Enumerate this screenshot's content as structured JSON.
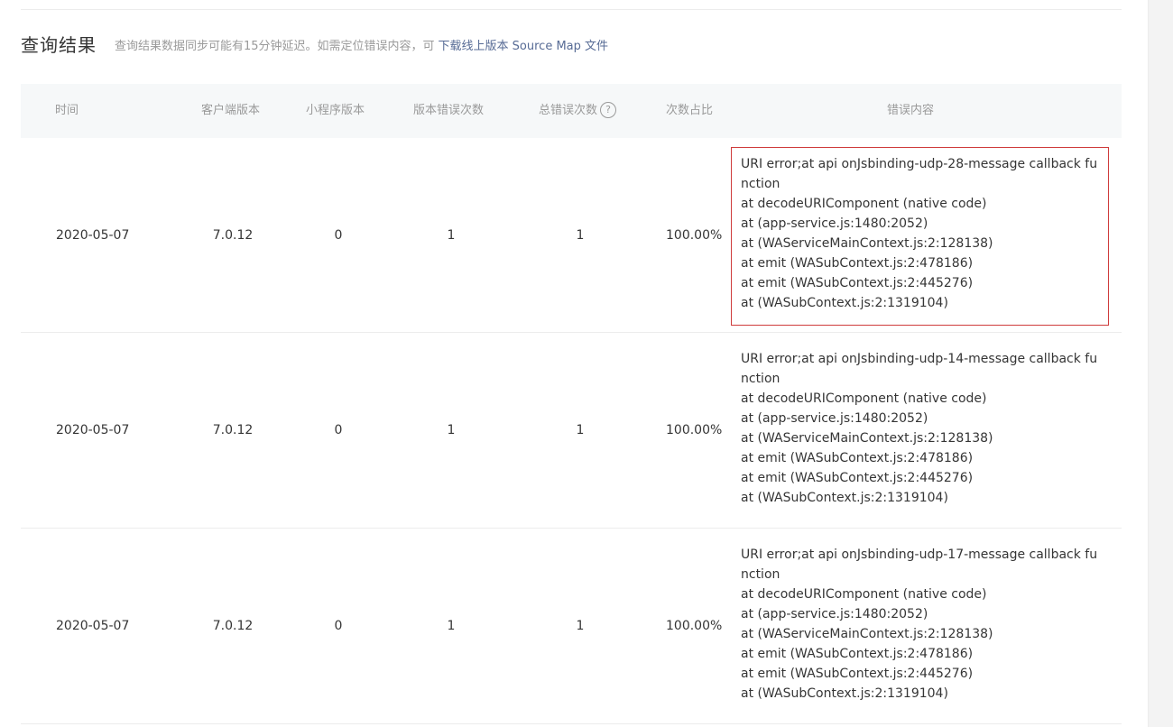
{
  "header": {
    "title": "查询结果",
    "description": "查询结果数据同步可能有15分钟延迟。如需定位错误内容，可",
    "link_label": "下载线上版本 Source Map 文件"
  },
  "table": {
    "columns": {
      "time": "时间",
      "client_version": "客户端版本",
      "miniprogram_version": "小程序版本",
      "version_error_count": "版本错误次数",
      "total_error_count": "总错误次数",
      "ratio": "次数占比",
      "error_content": "错误内容"
    },
    "help_icon_glyph": "?",
    "rows": [
      {
        "time": "2020-05-07",
        "client_version": "7.0.12",
        "miniprogram_version": "0",
        "version_error_count": "1",
        "total_error_count": "1",
        "ratio": "100.00%",
        "error_lines": [
          "URI error;at api onJsbinding-udp-28-message callback fu",
          "nction",
          "at decodeURIComponent (native code)",
          "at (app-service.js:1480:2052)",
          "at (WAServiceMainContext.js:2:128138)",
          "at emit (WASubContext.js:2:478186)",
          "at emit (WASubContext.js:2:445276)",
          "at (WASubContext.js:2:1319104)"
        ]
      },
      {
        "time": "2020-05-07",
        "client_version": "7.0.12",
        "miniprogram_version": "0",
        "version_error_count": "1",
        "total_error_count": "1",
        "ratio": "100.00%",
        "error_lines": [
          "URI error;at api onJsbinding-udp-14-message callback fu",
          "nction",
          "at decodeURIComponent (native code)",
          "at (app-service.js:1480:2052)",
          "at (WAServiceMainContext.js:2:128138)",
          "at emit (WASubContext.js:2:478186)",
          "at emit (WASubContext.js:2:445276)",
          "at (WASubContext.js:2:1319104)"
        ]
      },
      {
        "time": "2020-05-07",
        "client_version": "7.0.12",
        "miniprogram_version": "0",
        "version_error_count": "1",
        "total_error_count": "1",
        "ratio": "100.00%",
        "error_lines": [
          "URI error;at api onJsbinding-udp-17-message callback fu",
          "nction",
          "at decodeURIComponent (native code)",
          "at (app-service.js:1480:2052)",
          "at (WAServiceMainContext.js:2:128138)",
          "at emit (WASubContext.js:2:478186)",
          "at emit (WASubContext.js:2:445276)",
          "at (WASubContext.js:2:1319104)"
        ]
      }
    ]
  },
  "colors": {
    "highlight_border": "#cf3c3c",
    "link": "#576b95",
    "header_background": "#f6f8f9"
  }
}
